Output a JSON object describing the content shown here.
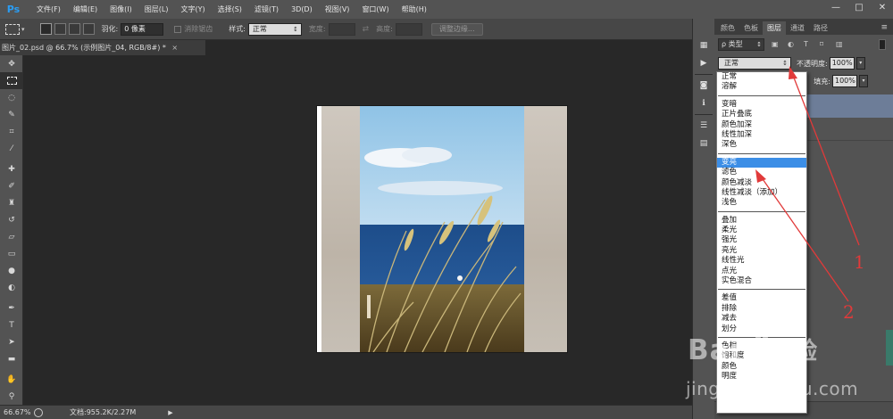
{
  "app": {
    "logo": "Ps"
  },
  "menubar": {
    "items": [
      "文件(F)",
      "编辑(E)",
      "图像(I)",
      "图层(L)",
      "文字(Y)",
      "选择(S)",
      "滤镜(T)",
      "3D(D)",
      "视图(V)",
      "窗口(W)",
      "帮助(H)"
    ],
    "window_controls": [
      "—",
      "□",
      "✕"
    ]
  },
  "options_bar": {
    "feather_label": "羽化:",
    "feather_value": "0 像素",
    "antialias_label": "消除锯齿",
    "style_label": "样式:",
    "style_value": "正常",
    "width_label": "宽度:",
    "height_label": "高度:",
    "refine_edge_label": "调整边缘..."
  },
  "document": {
    "tab_title": "图片_02.psd @ 66.7% (示例图片_04, RGB/8#) *",
    "close": "×"
  },
  "status_bar": {
    "zoom": "66.67%",
    "doc_info": "文档:955.2K/2.27M",
    "arrow": "▶"
  },
  "panel": {
    "tabs": [
      "颜色",
      "色板",
      "图层",
      "通道",
      "路径"
    ],
    "active_tab": "图层",
    "menu_icon": "≡",
    "filter_label": "ρ 类型",
    "blend_mode": "正常",
    "opacity_label": "不透明度:",
    "opacity_value": "100%",
    "fill_label": "填充:",
    "fill_value": "100%"
  },
  "blend_dropdown": {
    "groups": [
      [
        "正常",
        "溶解"
      ],
      [
        "变暗",
        "正片叠底",
        "颜色加深",
        "线性加深",
        "深色"
      ],
      [
        "变亮",
        "滤色",
        "颜色减淡",
        "线性减淡（添加）",
        "浅色"
      ],
      [
        "叠加",
        "柔光",
        "强光",
        "亮光",
        "线性光",
        "点光",
        "实色混合"
      ],
      [
        "差值",
        "排除",
        "减去",
        "划分"
      ],
      [
        "色相",
        "饱和度",
        "颜色",
        "明度"
      ]
    ],
    "selected": "变亮"
  },
  "annotations": {
    "label_1": "1",
    "label_2": "2",
    "color": "#e13a3a"
  },
  "watermark": {
    "top": "Bai",
    "top_suffix": "经验",
    "bottom": "jingyan.baidu.com"
  }
}
